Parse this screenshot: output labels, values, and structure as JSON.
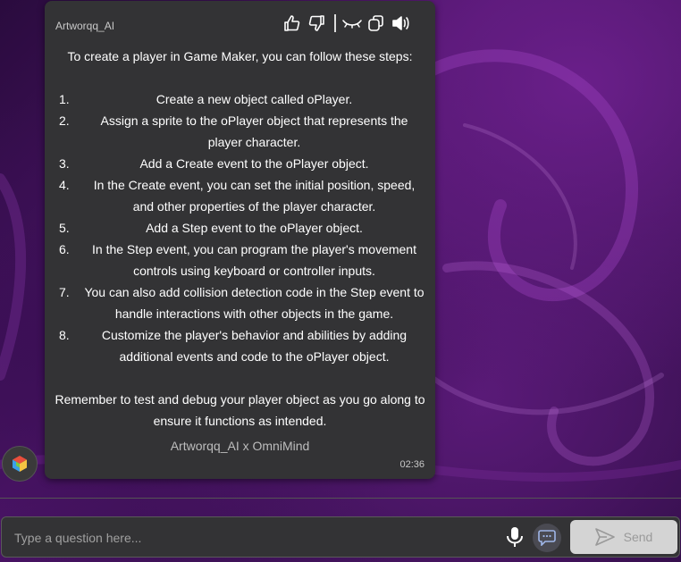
{
  "message": {
    "sender": "Artworqq_AI",
    "intro": "To create a player in Game Maker, you can follow these steps:",
    "steps": [
      {
        "num": "1.",
        "text": "Create a new object called oPlayer."
      },
      {
        "num": "2.",
        "text": "Assign a sprite to the oPlayer object that represents the player character."
      },
      {
        "num": "3.",
        "text": "Add a Create event to the oPlayer object."
      },
      {
        "num": "4.",
        "text": "In the Create event, you can set the initial position, speed, and other properties of the player character."
      },
      {
        "num": "5.",
        "text": "Add a Step event to the oPlayer object."
      },
      {
        "num": "6.",
        "text": "In the Step event, you can program the player's movement controls using keyboard or controller inputs."
      },
      {
        "num": "7.",
        "text": "You can also add collision detection code in the Step event to handle interactions with other objects in the game."
      },
      {
        "num": "8.",
        "text": "Customize the player's behavior and abilities by adding additional events and code to the oPlayer object."
      }
    ],
    "outro": "Remember to test and debug your player object as you go along to ensure it functions as intended.",
    "footer": "Artworqq_AI x OmniMind",
    "time": "02:36",
    "action_icons": [
      "thumbs-up-icon",
      "thumbs-down-icon",
      "eye-closed-icon",
      "copy-icon",
      "speaker-icon"
    ]
  },
  "input": {
    "placeholder": "Type a question here...",
    "send_label": "Send"
  },
  "colors": {
    "bubble": "#333335",
    "send_bg": "#d4d4d4",
    "background_accent": "#6a1f8a"
  }
}
